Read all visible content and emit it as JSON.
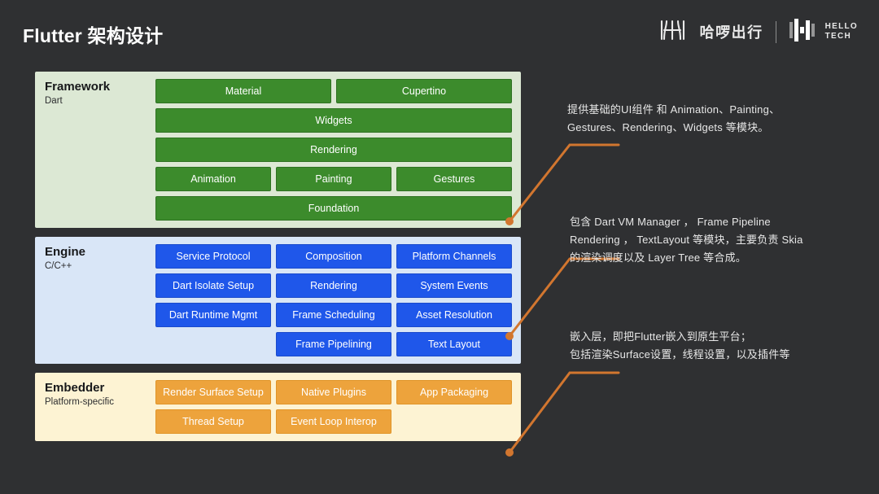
{
  "header": {
    "title": "Flutter 架构设计",
    "brand_cn": "哈啰出行",
    "brand_en_line1": "HELLO",
    "brand_en_line2": "TECH"
  },
  "colors": {
    "background": "#2f3032",
    "framework_panel": "#dce8d4",
    "engine_panel": "#d9e6f7",
    "embedder_panel": "#fdf3d3",
    "framework_box": "#3c8b2c",
    "engine_box": "#1f57ea",
    "embedder_box": "#eda33c",
    "connector": "#d2762f",
    "title_text": "#ffffff",
    "annotation_text": "#e7e7e7"
  },
  "diagram": {
    "layers": [
      {
        "name": "Framework",
        "sublabel": "Dart",
        "rows": [
          [
            "Material",
            "Cupertino"
          ],
          [
            "Widgets"
          ],
          [
            "Rendering"
          ],
          [
            "Animation",
            "Painting",
            "Gestures"
          ],
          [
            "Foundation"
          ]
        ]
      },
      {
        "name": "Engine",
        "sublabel": "C/C++",
        "rows": [
          [
            "Service Protocol",
            "Composition",
            "Platform Channels"
          ],
          [
            "Dart Isolate Setup",
            "Rendering",
            "System Events"
          ],
          [
            "Dart Runtime Mgmt",
            "Frame Scheduling",
            "Asset Resolution"
          ],
          [
            "Frame Pipelining",
            "Text Layout"
          ]
        ]
      },
      {
        "name": "Embedder",
        "sublabel": "Platform-specific",
        "rows": [
          [
            "Render Surface Setup",
            "Native Plugins",
            "App Packaging"
          ],
          [
            "Thread Setup",
            "Event Loop Interop"
          ]
        ]
      }
    ]
  },
  "annotations": [
    {
      "text": "提供基础的UI组件 和 Animation、Painting、\nGestures、Rendering、Widgets 等模块。"
    },
    {
      "text": "包含 Dart VM Manager ， Frame Pipeline\nRendering ， TextLayout 等模块，主要负责 Skia\n的渲染调度以及 Layer Tree 等合成。"
    },
    {
      "text": "嵌入层，即把Flutter嵌入到原生平台；\n包括渲染Surface设置，线程设置，以及插件等"
    }
  ]
}
